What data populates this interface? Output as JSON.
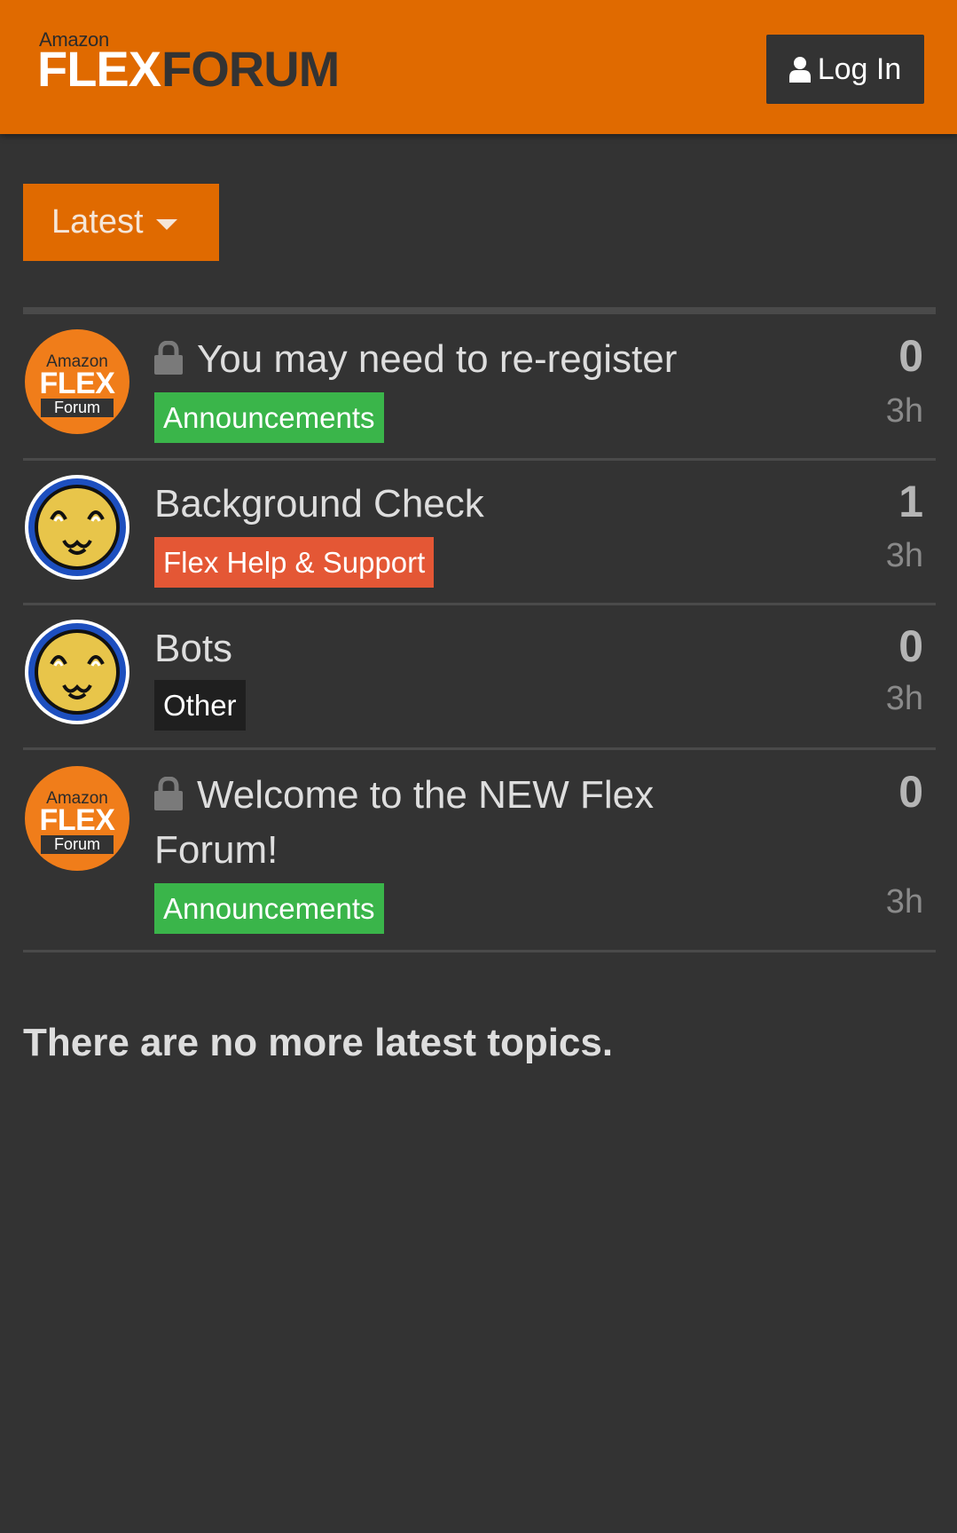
{
  "header": {
    "logo_small": "Amazon",
    "logo_flex": "FLEX",
    "logo_forum": "FORUM",
    "login_label": "Log In"
  },
  "filter": {
    "selected": "Latest"
  },
  "avatar_text": {
    "amazon": "Amazon",
    "flex": "FLEX",
    "forum": "Forum"
  },
  "topics": [
    {
      "title": "You may need to re-register",
      "locked": true,
      "category": "Announcements",
      "category_color": "#3ab54a",
      "replies": "0",
      "age": "3h",
      "avatar": "amazon-flex-forum"
    },
    {
      "title": "Background Check",
      "locked": false,
      "category": "Flex Help & Support",
      "category_color": "#e45735",
      "replies": "1",
      "age": "3h",
      "avatar": "smiley-face"
    },
    {
      "title": "Bots",
      "locked": false,
      "category": "Other",
      "category_color": "#1f1f1f",
      "replies": "0",
      "age": "3h",
      "avatar": "smiley-face"
    },
    {
      "title": "Welcome to the NEW Flex Forum!",
      "locked": true,
      "category": "Announcements",
      "category_color": "#3ab54a",
      "replies": "0",
      "age": "3h",
      "avatar": "amazon-flex-forum"
    }
  ],
  "footer": {
    "message": "There are no more latest topics."
  },
  "colors": {
    "brand": "#e06a00",
    "background": "#333333"
  }
}
